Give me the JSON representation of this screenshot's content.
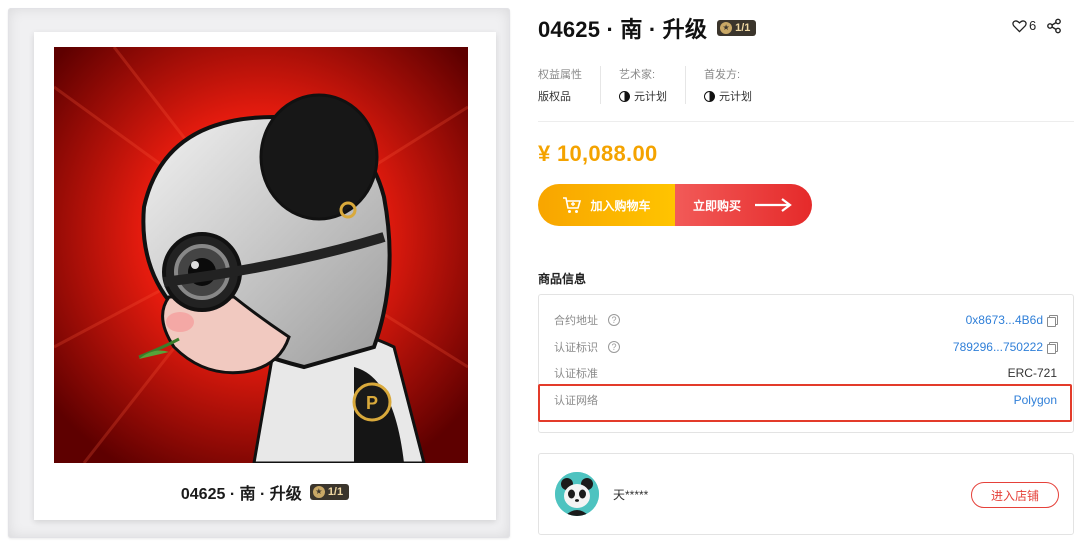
{
  "artwork": {
    "caption": "04625 · 南 · 升级",
    "edition": "1/1"
  },
  "product": {
    "title": "04625 · 南 · 升级",
    "edition": "1/1",
    "likes": "6",
    "price": "¥ 10,088.00"
  },
  "meta": [
    {
      "label": "权益属性",
      "value": "版权品",
      "icon": ""
    },
    {
      "label": "艺术家:",
      "value": "元计划",
      "icon": "yin-yang-icon"
    },
    {
      "label": "首发方:",
      "value": "元计划",
      "icon": "yin-yang-icon"
    }
  ],
  "actions": {
    "cart": "加入购物车",
    "buy": "立即购买"
  },
  "info": {
    "section_title": "商品信息",
    "rows": [
      {
        "key": "合约地址",
        "value": "0x8673...4B6d",
        "help": true,
        "copy": true
      },
      {
        "key": "认证标识",
        "value": "789296...750222",
        "help": true,
        "copy": true
      },
      {
        "key": "认证标准",
        "value": "ERC-721",
        "help": false,
        "copy": false
      },
      {
        "key": "认证网络",
        "value": "Polygon",
        "help": false,
        "copy": false
      }
    ]
  },
  "seller": {
    "name": "天*****",
    "shop_button": "进入店铺"
  },
  "colors": {
    "price": "#f4a300",
    "link": "#2f7fd8",
    "accent_red": "#e5413a",
    "highlight_border": "#e33b2a",
    "cart_gradient": [
      "#f8a500",
      "#ffc400"
    ],
    "buy_gradient": [
      "#f25a58",
      "#e52a2a"
    ]
  }
}
